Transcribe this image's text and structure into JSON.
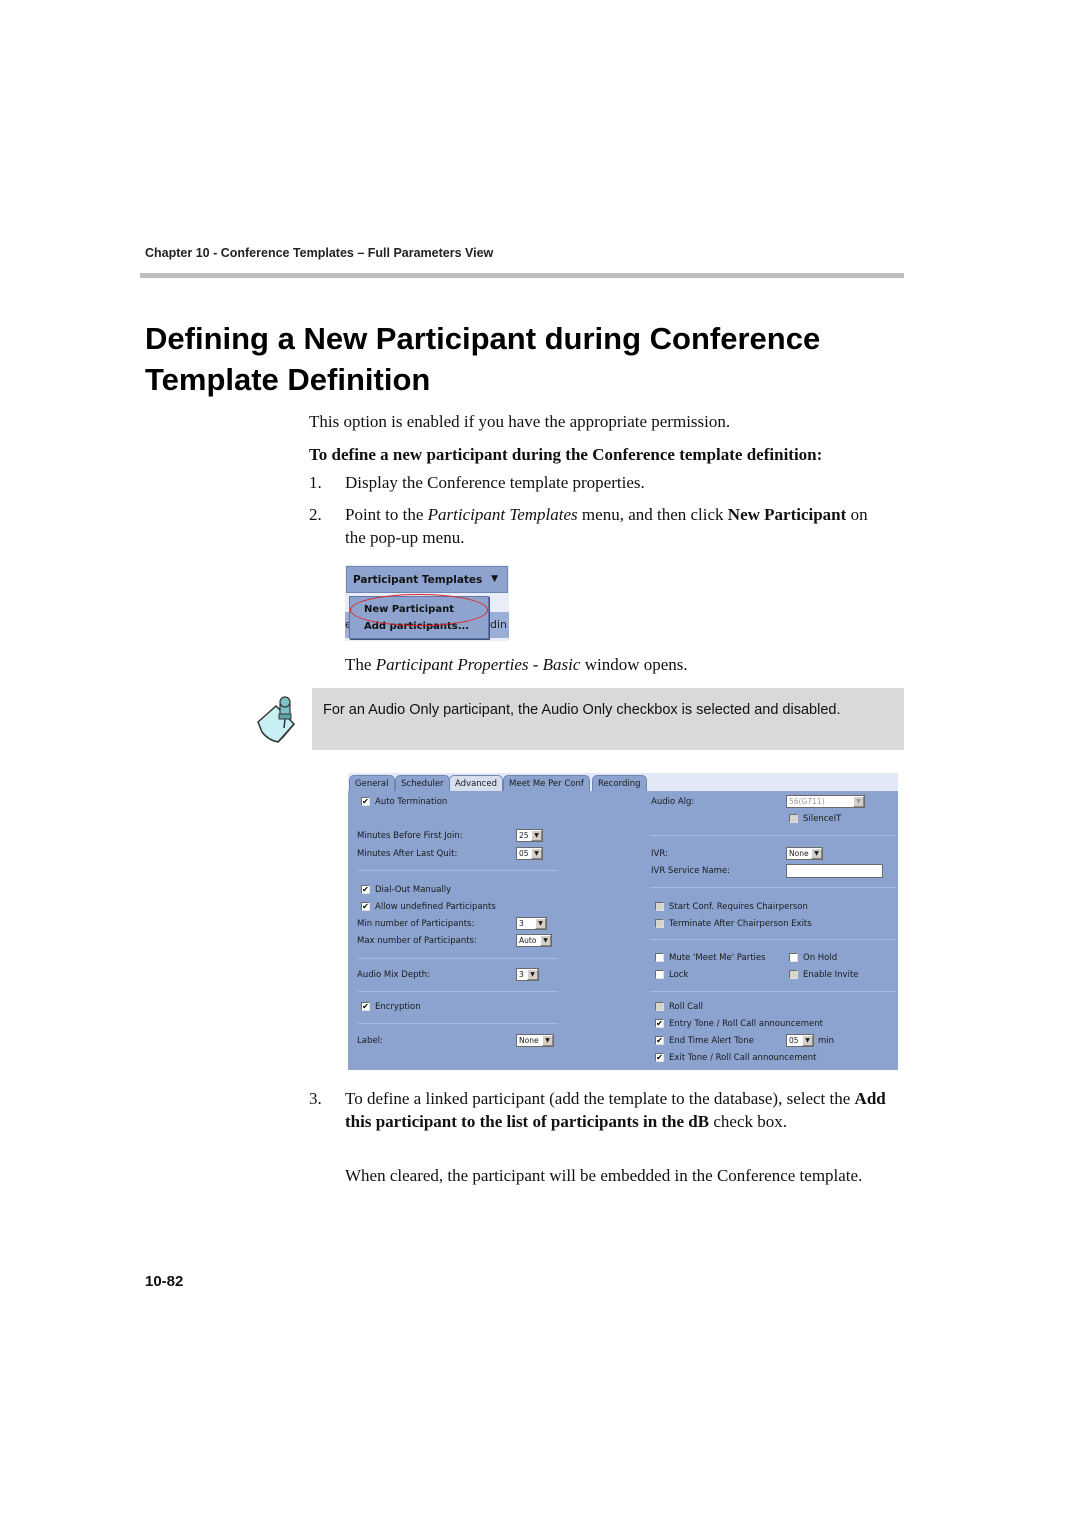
{
  "running_head": "Chapter 10 - Conference Templates – Full Parameters View",
  "title": "Defining a New Participant during Conference Template Definition",
  "intro": "This option is enabled if you have the appropriate permission.",
  "procedure_heading": "To define a new participant during the Conference template definition:",
  "steps": [
    {
      "num": "1.",
      "text": "Display the Conference template properties."
    },
    {
      "num": "2.",
      "pre": "Point to the ",
      "italic": "Participant Templates",
      "mid": " menu, and then click ",
      "bold": "New Participant",
      "post": " on the pop-up menu."
    },
    {
      "num": "3.",
      "pre": "To define a linked participant (add the template to the database), select the ",
      "bold": "Add this participant to the list of participants in the dB",
      "post": " check box."
    }
  ],
  "menu_screenshot": {
    "menu_label": "Participant Templates",
    "arrow": "▼",
    "items": [
      "New Participant",
      "Add participants..."
    ],
    "bg_left_fragment": "el",
    "bg_right_fragment": "din"
  },
  "window_opens": {
    "pre": "The ",
    "italic": "Participant Properties - Basic",
    "post": " window opens."
  },
  "note": {
    "icon": "note-pin-icon",
    "text": "For an Audio Only participant, the Audio Only checkbox is selected and disabled."
  },
  "dialog": {
    "tabs": [
      "General",
      "Scheduler",
      "Advanced",
      "Meet Me Per Conf",
      "Recording"
    ],
    "active_tab": "Advanced",
    "left": {
      "auto_termination": {
        "label": "Auto Termination",
        "checked": true
      },
      "minutes_before_first_join": {
        "label": "Minutes Before First Join:",
        "value": "25"
      },
      "minutes_after_last_quit": {
        "label": "Minutes After Last Quit:",
        "value": "05"
      },
      "dial_out_manually": {
        "label": "Dial-Out Manually",
        "checked": true
      },
      "allow_undefined": {
        "label": "Allow undefined Participants",
        "checked": true
      },
      "min_participants": {
        "label": "Min number of Participants:",
        "value": "3"
      },
      "max_participants": {
        "label": "Max number of Participants:",
        "value": "Auto"
      },
      "audio_mix_depth": {
        "label": "Audio Mix Depth:",
        "value": "3"
      },
      "encryption": {
        "label": "Encryption",
        "checked": true
      },
      "label_field": {
        "label": "Label:",
        "value": "None"
      }
    },
    "right": {
      "audio_alg": {
        "label": "Audio Alg:",
        "value": "56(G711)"
      },
      "silenceit": {
        "label": "SilenceIT",
        "checked": false
      },
      "ivr": {
        "label": "IVR:",
        "value": "None"
      },
      "ivr_service_name": {
        "label": "IVR Service Name:",
        "value": ""
      },
      "start_conf_requires_chair": {
        "label": "Start Conf. Requires Chairperson",
        "checked": false
      },
      "terminate_after_chair_exits": {
        "label": "Terminate After Chairperson Exits",
        "checked": false
      },
      "mute_meet_me": {
        "label": "Mute 'Meet Me' Parties",
        "checked": false
      },
      "on_hold": {
        "label": "On Hold",
        "checked": false
      },
      "lock": {
        "label": "Lock",
        "checked": false
      },
      "enable_invite": {
        "label": "Enable Invite",
        "checked": false
      },
      "roll_call": {
        "label": "Roll Call",
        "checked": false
      },
      "entry_tone": {
        "label": "Entry Tone / Roll Call announcement",
        "checked": true
      },
      "end_time_alert_tone": {
        "label": "End Time Alert Tone",
        "checked": true,
        "value": "05",
        "unit": "min"
      },
      "exit_tone": {
        "label": "Exit Tone / Roll Call announcement",
        "checked": true
      }
    }
  },
  "cleared_text": "When cleared, the participant will be embedded in the Conference template.",
  "page_number": "10-82"
}
